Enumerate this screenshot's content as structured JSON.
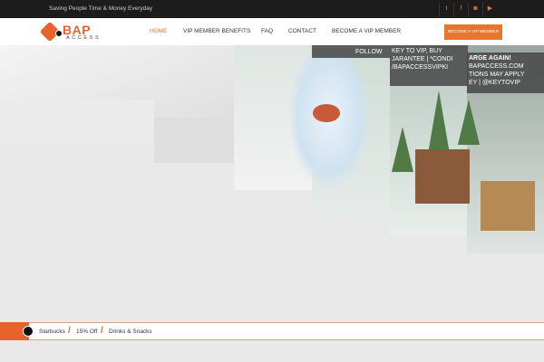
{
  "topbar": {
    "tagline": "Saving People Time & Money Everyday",
    "social": [
      {
        "icon": "twitter-icon",
        "glyph": "t"
      },
      {
        "icon": "facebook-icon",
        "glyph": "f"
      },
      {
        "icon": "instagram-icon",
        "glyph": "◙"
      },
      {
        "icon": "youtube-icon",
        "glyph": "▶"
      }
    ]
  },
  "logo": {
    "main": "BAP",
    "sub": "ACCESS"
  },
  "nav": {
    "items": [
      "HOME",
      "VIP MEMBER BENEFITS",
      "FAQ",
      "CONTACT",
      "BECOME A VIP MEMBER"
    ],
    "cta": "BECOME A VIP MEMBER"
  },
  "hero": {
    "overlay": [
      "FOLLOW",
      "KEY TO VIP, BUY",
      "JARANTEE | *CONDI",
      "/BAPACCESSVIPKI",
      "ARGE AGAIN!",
      "BAPACCESS.COM",
      "TIONS MAY APPLY",
      "EY |",
      "@KEYTOVIP"
    ]
  },
  "ticker": {
    "items": [
      "Starbucks",
      "15% Off",
      "Drinks & Snacks"
    ],
    "separator": "/"
  },
  "colors": {
    "accent": "#e8762d",
    "dark": "#1c1c1c"
  }
}
